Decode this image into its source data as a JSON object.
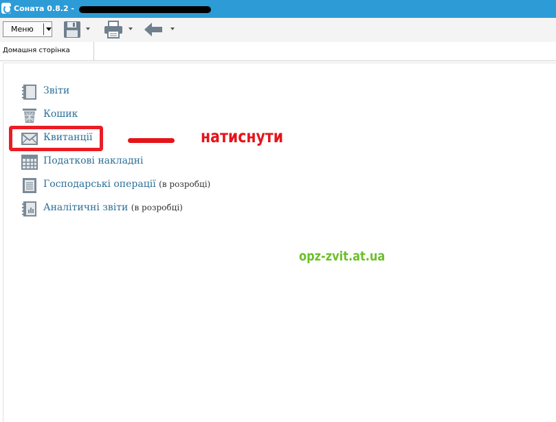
{
  "window": {
    "title": "Соната 0.8.2 -"
  },
  "toolbar": {
    "menu_label": "Меню",
    "icons": [
      "save-icon",
      "print-icon",
      "back-arrow-icon"
    ]
  },
  "tabs": [
    {
      "label": "Домашня сторінка",
      "active": true
    }
  ],
  "nav": {
    "items": [
      {
        "label": "Звіти",
        "note": "",
        "icon": "notebook-icon"
      },
      {
        "label": "Кошик",
        "note": "",
        "icon": "trash-icon"
      },
      {
        "label": "Квитанції",
        "note": "",
        "icon": "envelope-icon"
      },
      {
        "label": "Податкові накладні",
        "note": "",
        "icon": "table-grid-icon"
      },
      {
        "label": "Господарські операції",
        "note": "(в розробці)",
        "icon": "document-lines-icon"
      },
      {
        "label": "Аналітичні звіти",
        "note": "(в розробці)",
        "icon": "chart-notebook-icon"
      }
    ]
  },
  "annotation": {
    "text": "натиснути",
    "color": "#e5141b"
  },
  "watermark": {
    "text": "opz-zvit.at.ua",
    "color": "#6cc02a"
  },
  "colors": {
    "titlebar": "#2d9cd6",
    "link": "#2a6f97",
    "highlight": "#ea1c24"
  }
}
